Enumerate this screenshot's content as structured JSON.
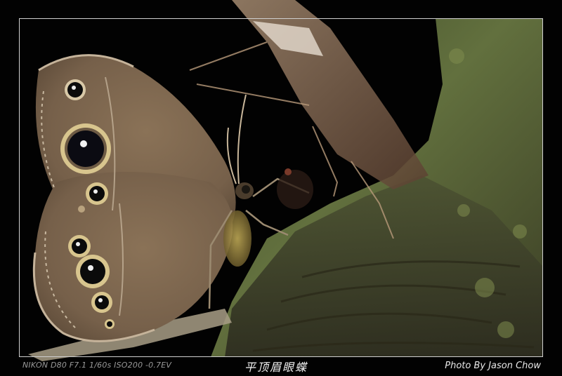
{
  "caption": {
    "exif": "NIKON D80 F7.1 1/60s ISO200 -0.7EV",
    "title": "平顶眉眼蝶",
    "credit": "Photo By Jason Chow"
  },
  "colors": {
    "background": "#000000",
    "frame": "#cfcfcf",
    "wing_brown": "#7d6448",
    "moss": "#5b6a3a"
  }
}
